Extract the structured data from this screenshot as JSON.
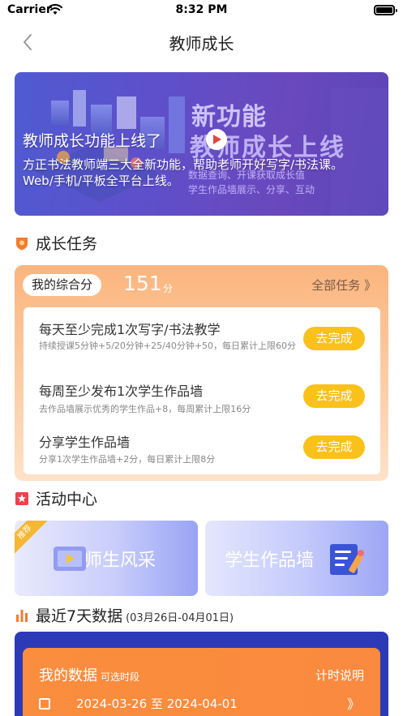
{
  "status_bar": {
    "carrier": "Carrier",
    "time": "8:32 PM"
  },
  "nav": {
    "title": "教师成长"
  },
  "banner": {
    "title": "教师成长功能上线了",
    "description": "方正书法教师端三大全新功能，帮助老师开好写字/书法课。Web/手机/平板全平台上线。",
    "art_heading_1": "新功能",
    "art_heading_2": "教师成长上线",
    "art_line_1": "数据查询、开课获取成长值",
    "art_line_2": "学生作品墙展示、分享、互动"
  },
  "growth_tasks": {
    "section_title": "成长任务",
    "score_label": "我的综合分",
    "score_value": "151",
    "score_unit": "分",
    "all_tasks_link": "全部任务 》",
    "tasks": [
      {
        "title": "每天至少完成1次写字/书法教学",
        "desc": "持续授课5分钟+5/20分钟+25/40分钟+50，每日累计上限60分",
        "button": "去完成"
      },
      {
        "title": "每周至少发布1次学生作品墙",
        "desc": "去作品墙展示优秀的学生作品+8，每周累计上限16分",
        "button": "去完成"
      },
      {
        "title": "分享学生作品墙",
        "desc": "分享1次学生作品墙+2分，每日累计上限8分",
        "button": "去完成"
      }
    ]
  },
  "activity": {
    "section_title": "活动中心",
    "ribbon": "推荐",
    "card_left": "师生风采",
    "card_right": "学生作品墙"
  },
  "recent_data": {
    "section_title": "最近7天数据",
    "date_range_label": "(03月26日-04月01日)",
    "card_title": "我的数据",
    "card_subtitle": "可选时段",
    "help_link": "计时说明",
    "range_text": "2024-03-26 至 2024-04-01",
    "range_arrow": "》"
  },
  "colors": {
    "accent_orange": "#fbb57e",
    "button_yellow": "#f9c11a",
    "banner_purple": "#5f4fc9",
    "data_blue": "#2d3ab8",
    "data_orange": "#fb8d3e",
    "icon_red": "#e4463f"
  }
}
